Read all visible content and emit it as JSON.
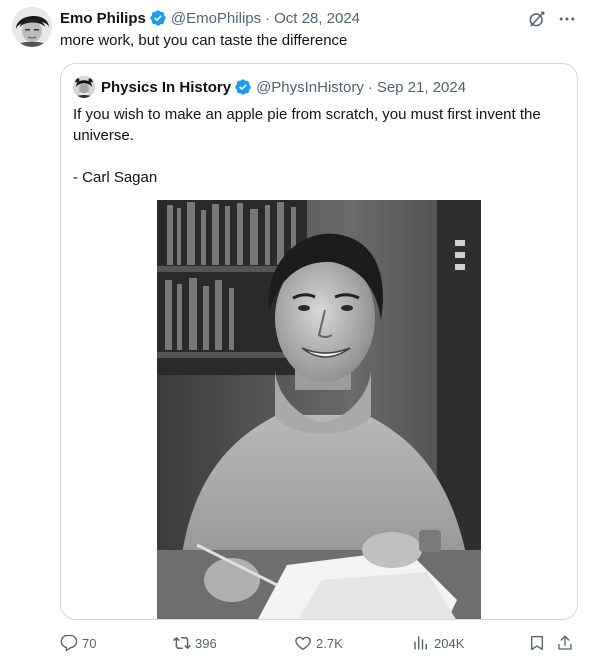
{
  "tweet": {
    "author_name": "Emo Philips",
    "handle": "@EmoPhilips",
    "date": "Oct 28, 2024",
    "text": "more work, but you can taste the difference",
    "separator": "·"
  },
  "quote": {
    "author_name": "Physics In History",
    "handle": "@PhysInHistory",
    "date": "Sep 21, 2024",
    "line1": "If you wish to make an apple pie from scratch, you must first invent the",
    "line2": "universe.",
    "line3": "- Carl Sagan"
  },
  "actions": {
    "replies": "70",
    "reposts": "396",
    "likes": "2.7K",
    "views": "204K"
  },
  "colors": {
    "verified": "#1d9bf0",
    "muted": "#536471",
    "border": "#cfd9de"
  },
  "icons": [
    "verified-badge-icon",
    "grok-icon",
    "more-icon",
    "reply-icon",
    "repost-icon",
    "like-icon",
    "views-icon",
    "bookmark-icon",
    "share-icon"
  ]
}
